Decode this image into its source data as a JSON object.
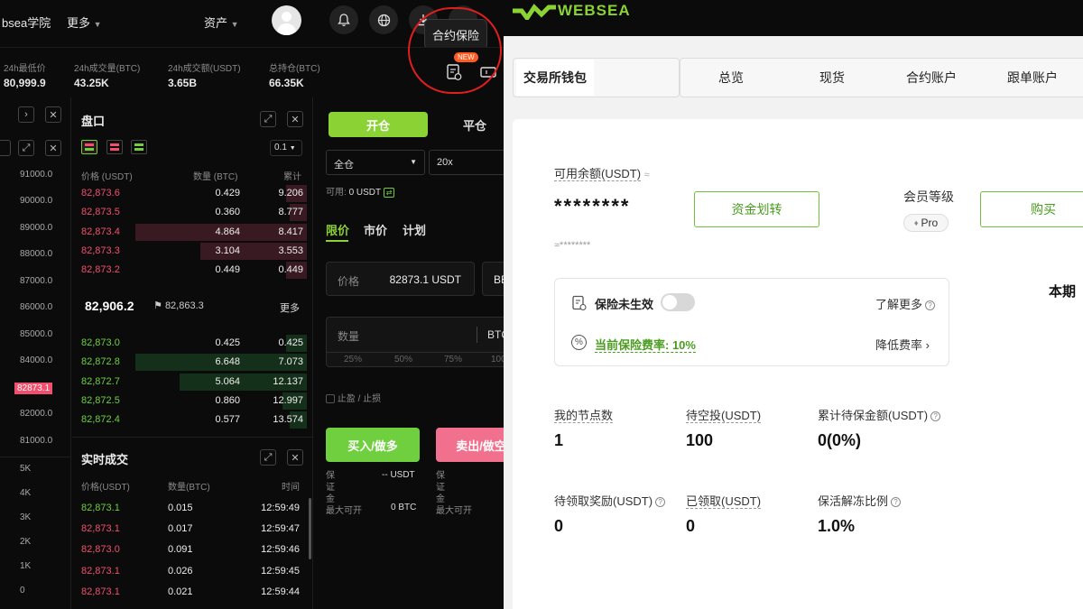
{
  "topbar": {
    "academy": "bsea学院",
    "more": "更多",
    "assets": "资产"
  },
  "tooltip": {
    "label": "合约保险",
    "badge": "NEW"
  },
  "stats": [
    {
      "label": "24h最低价",
      "value": "80,999.9"
    },
    {
      "label": "24h成交量(BTC)",
      "value": "43.25K"
    },
    {
      "label": "24h成交额(USDT)",
      "value": "3.65B"
    },
    {
      "label": "总持仓(BTC)",
      "value": "66.35K"
    }
  ],
  "chart_axis": [
    "91000.0",
    "90000.0",
    "89000.0",
    "88000.0",
    "87000.0",
    "86000.0",
    "85000.0",
    "84000.0",
    "82873.1",
    "82000.0",
    "81000.0"
  ],
  "volume_axis": [
    "5K",
    "4K",
    "3K",
    "2K",
    "1K",
    "0"
  ],
  "orderbook": {
    "title": "盘口",
    "step": "0.1",
    "headers": {
      "price": "价格 (USDT)",
      "qty": "数量 (BTC)",
      "total": "累计"
    },
    "asks": [
      {
        "price": "82,873.6",
        "qty": "0.429",
        "total": "9.206",
        "depth": 0.12
      },
      {
        "price": "82,873.5",
        "qty": "0.360",
        "total": "8.777",
        "depth": 0.1
      },
      {
        "price": "82,873.4",
        "qty": "4.864",
        "total": "8.417",
        "depth": 1.0
      },
      {
        "price": "82,873.3",
        "qty": "3.104",
        "total": "3.553",
        "depth": 0.62
      },
      {
        "price": "82,873.2",
        "qty": "0.449",
        "total": "0.449",
        "depth": 0.12
      }
    ],
    "last_price": "82,906.2",
    "mark_price": "82,863.3",
    "more": "更多",
    "bids": [
      {
        "price": "82,873.0",
        "qty": "0.425",
        "total": "0.425",
        "depth": 0.12
      },
      {
        "price": "82,872.8",
        "qty": "6.648",
        "total": "7.073",
        "depth": 1.0
      },
      {
        "price": "82,872.7",
        "qty": "5.064",
        "total": "12.137",
        "depth": 0.74
      },
      {
        "price": "82,872.5",
        "qty": "0.860",
        "total": "12.997",
        "depth": 0.14
      },
      {
        "price": "82,872.4",
        "qty": "0.577",
        "total": "13.574",
        "depth": 0.1
      }
    ]
  },
  "trades": {
    "title": "实时成交",
    "headers": {
      "price": "价格(USDT)",
      "qty": "数量(BTC)",
      "time": "时间"
    },
    "rows": [
      {
        "price": "82,873.1",
        "qty": "0.015",
        "time": "12:59:49",
        "side": "buy"
      },
      {
        "price": "82,873.1",
        "qty": "0.017",
        "time": "12:59:47",
        "side": "sell"
      },
      {
        "price": "82,873.0",
        "qty": "0.091",
        "time": "12:59:46",
        "side": "sell"
      },
      {
        "price": "82,873.1",
        "qty": "0.026",
        "time": "12:59:45",
        "side": "sell"
      },
      {
        "price": "82,873.1",
        "qty": "0.021",
        "time": "12:59:44",
        "side": "sell"
      }
    ]
  },
  "order_form": {
    "open": "开仓",
    "close": "平仓",
    "margin_mode": "全仓",
    "leverage": "20x",
    "available_label": "可用:",
    "available_value": "0 USDT",
    "types": [
      "限价",
      "市价",
      "计划"
    ],
    "price_label": "价格",
    "price_value": "82873.1 USDT",
    "bbo": "BB",
    "qty_label": "数量",
    "qty_unit": "BTC",
    "percents": [
      "25%",
      "50%",
      "75%",
      "100"
    ],
    "tpsl": "止盈 / 止损",
    "buy": "买入/做多",
    "sell": "卖出/做空",
    "margin_label": "保证金",
    "margin_value": "-- USDT",
    "max_label": "最大可开",
    "max_value": "0 BTC",
    "margin_label2": "保证金",
    "max_label2": "最大可开"
  },
  "brand": {
    "name": "WEBSEA",
    "accent": "#8bd235"
  },
  "wallet_tabs": [
    "交易所钱包",
    "总览",
    "现货",
    "合约账户",
    "跟单账户"
  ],
  "account": {
    "balance_label": "可用余额(USDT)",
    "balance_value": "********",
    "balance_sub": "≈********",
    "transfer": "资金划转",
    "member_label": "会员等级",
    "member_badge": "Pro",
    "buy": "购买",
    "period": "本期",
    "insurance_status": "保险未生效",
    "learn_more": "了解更多",
    "rate_label": "当前保险费率: 10%",
    "reduce_rate": "降低费率"
  },
  "metrics": [
    {
      "label": "我的节点数",
      "value": "1"
    },
    {
      "label": "待空投(USDT)",
      "value": "100"
    },
    {
      "label": "累计待保金额(USDT)",
      "value": "0(0%)"
    },
    {
      "label": "待领取奖励(USDT)",
      "value": "0"
    },
    {
      "label": "已领取(USDT)",
      "value": "0"
    },
    {
      "label": "保活解冻比例",
      "value": "1.0%"
    }
  ]
}
